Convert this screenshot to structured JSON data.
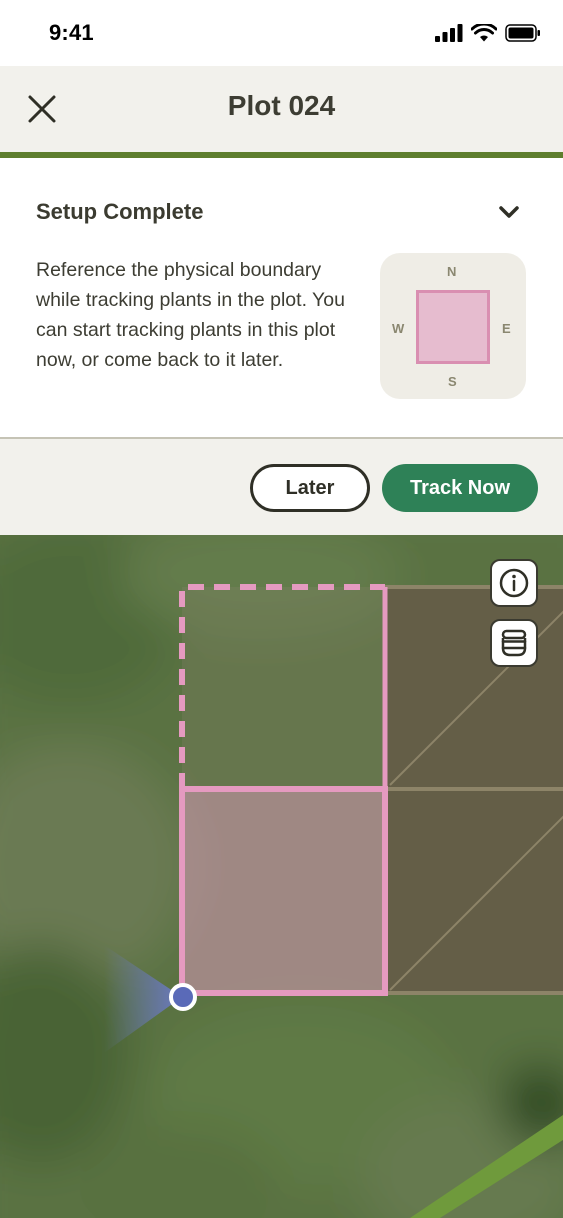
{
  "status_bar": {
    "time": "9:41",
    "icons": [
      "signal-icon",
      "wifi-icon",
      "battery-icon"
    ]
  },
  "header": {
    "title": "Plot 024",
    "close_icon": "close-icon"
  },
  "setup": {
    "title": "Setup Complete",
    "expanded": true,
    "description": "Reference the physical boundary while tracking plants in the plot. You can start tracking plants in this plot now, or come back to it later.",
    "compass": {
      "north": "N",
      "south": "S",
      "west": "W",
      "east": "E"
    }
  },
  "actions": {
    "later_label": "Later",
    "track_label": "Track Now"
  },
  "map": {
    "controls": [
      "info-icon",
      "layers-icon"
    ]
  },
  "colors": {
    "accent_green": "#5e7e2e",
    "primary_button": "#2e8157",
    "plot_pink": "#e6bccf",
    "plot_border": "#d98fb1",
    "location_dot": "#5a6ab8"
  }
}
